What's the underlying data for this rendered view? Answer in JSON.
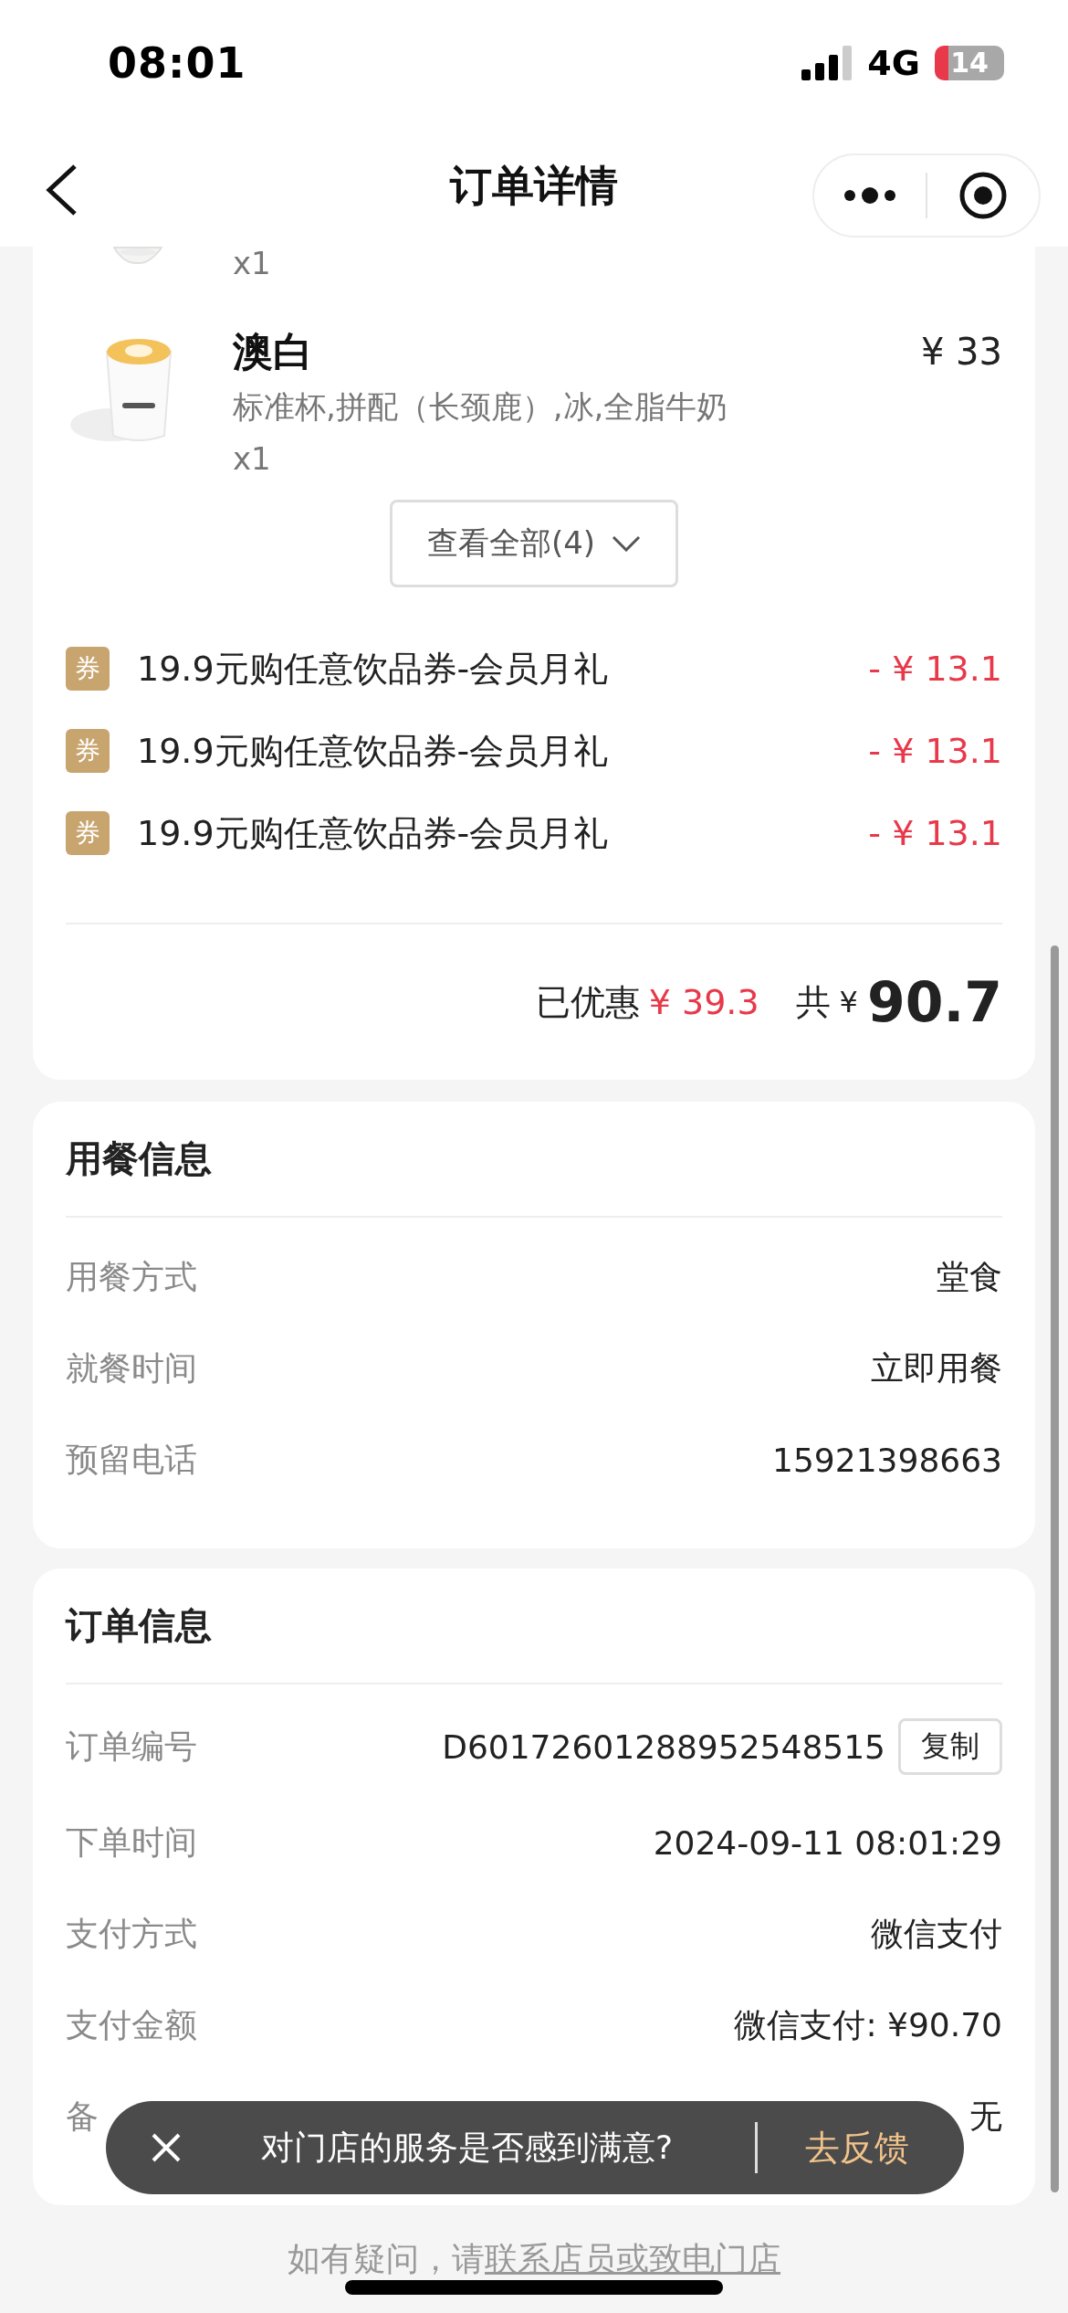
{
  "status_bar": {
    "time": "08:01",
    "network": "4G",
    "battery": "14"
  },
  "nav": {
    "title": "订单详情"
  },
  "items": [
    {
      "kind": "cut",
      "quantity": "x1"
    },
    {
      "kind": "full",
      "name": "澳白",
      "options": "标准杯,拼配（长颈鹿）,冰,全脂牛奶",
      "quantity": "x1",
      "price": "¥ 33"
    }
  ],
  "view_all": "查看全部(4)",
  "coupons": [
    {
      "badge": "券",
      "name": "19.9元购任意饮品券-会员月礼",
      "amount": "- ¥ 13.1"
    },
    {
      "badge": "券",
      "name": "19.9元购任意饮品券-会员月礼",
      "amount": "- ¥ 13.1"
    },
    {
      "badge": "券",
      "name": "19.9元购任意饮品券-会员月礼",
      "amount": "- ¥ 13.1"
    }
  ],
  "totals": {
    "discount_label": "已优惠",
    "discount": "¥ 39.3",
    "total_label": "共",
    "currency": "¥",
    "total": "90.7"
  },
  "sections": [
    {
      "title": "用餐信息",
      "rows": [
        {
          "label": "用餐方式",
          "value": "堂食"
        },
        {
          "label": "就餐时间",
          "value": "立即用餐"
        },
        {
          "label": "预留电话",
          "value": "15921398663"
        }
      ]
    },
    {
      "title": "订单信息",
      "rows": [
        {
          "label": "订单编号",
          "value": "D60172601288952548515",
          "action": "复制"
        },
        {
          "label": "下单时间",
          "value": "2024-09-11 08:01:29"
        },
        {
          "label": "支付方式",
          "value": "微信支付"
        },
        {
          "label": "支付金额",
          "value": "微信支付: ¥90.70"
        },
        {
          "label": "备",
          "value": "无"
        }
      ]
    }
  ],
  "footer": {
    "text": "如有疑问，请",
    "link": "联系店员或致电门店"
  },
  "toast": {
    "text": "对门店的服务是否感到满意?",
    "action": "去反馈"
  }
}
